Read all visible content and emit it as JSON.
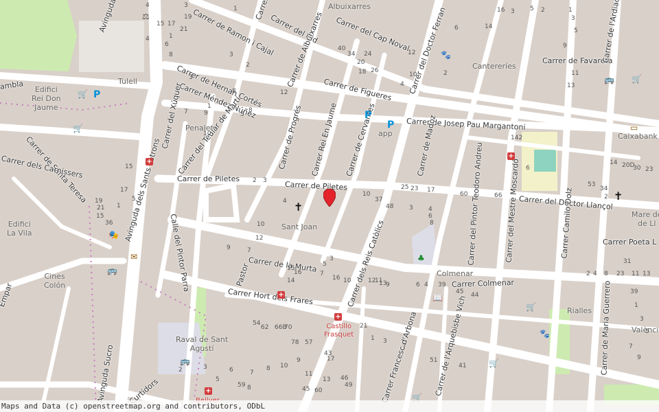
{
  "map": {
    "attribution": "Maps and Data (c) openstreetmap.org and contributors, ODbL",
    "marker": {
      "name": "location-pin-icon",
      "color": "#e3242b"
    },
    "colors": {
      "background": "#f2efe9",
      "buildings": "#d9d0c9",
      "roads": "#ffffff",
      "park": "#cdebb0",
      "pedestrian": "#dddde8"
    },
    "streets": [
      {
        "id": "s1",
        "label": "Avinguda Joan Calot"
      },
      {
        "id": "s2",
        "label": "Carrer de Ramon i Cajal"
      },
      {
        "id": "s3",
        "label": "Carrer del Cid"
      },
      {
        "id": "s4",
        "label": "Carrer del Cap Noval"
      },
      {
        "id": "s5",
        "label": "Carrer de Hernan Cortés"
      },
      {
        "id": "s6",
        "label": "Carrer de Albuixarres"
      },
      {
        "id": "s7",
        "label": "Carrer Méndez Núñez"
      },
      {
        "id": "s8",
        "label": "Carrer de Figueres"
      },
      {
        "id": "s9",
        "label": "Carrer del Doctor Ferran"
      },
      {
        "id": "s10",
        "label": "Carrer de Favareta"
      },
      {
        "id": "s11",
        "label": "Carrer de Josep Pau Margantoni"
      },
      {
        "id": "s12",
        "label": "Carrer del Teular de Martí"
      },
      {
        "id": "s13",
        "label": "Carrer del Xúquer"
      },
      {
        "id": "s14",
        "label": "Carrer de Progrés"
      },
      {
        "id": "s15",
        "label": "Carrer Rei En Jaume"
      },
      {
        "id": "s16",
        "label": "Carrer de Cervantes"
      },
      {
        "id": "s17",
        "label": "Carrer de Madoz"
      },
      {
        "id": "s18",
        "label": "Carrer de Piletes"
      },
      {
        "id": "s19",
        "label": "Carrer de Piletes"
      },
      {
        "id": "s20",
        "label": "Carrer del Pintor Teodoro Andreu"
      },
      {
        "id": "s21",
        "label": "Carrer del Mestre Moscardó"
      },
      {
        "id": "s22",
        "label": "Carrer del Doctor Llançol"
      },
      {
        "id": "s23",
        "label": "Carrer Camilo Dolz"
      },
      {
        "id": "s24",
        "label": "Carrer Poeta L"
      },
      {
        "id": "s25",
        "label": "Carrer de Santa Teresa"
      },
      {
        "id": "s26",
        "label": "Carrer dels Carnissers"
      },
      {
        "id": "s27",
        "label": "Avinguda dels Sants Patrons"
      },
      {
        "id": "s28",
        "label": "Calle del Pintor Parra"
      },
      {
        "id": "s29",
        "label": "Pastor"
      },
      {
        "id": "s30",
        "label": "Carrer de la Murta"
      },
      {
        "id": "s31",
        "label": "Carrer dels Reis Catòlics"
      },
      {
        "id": "s32",
        "label": "Carrer del Pintor Roig"
      },
      {
        "id": "s33",
        "label": "Carrer Colmenar"
      },
      {
        "id": "s34",
        "label": "Carrer Hort dels Frares"
      },
      {
        "id": "s35",
        "label": "Carrer Francesc d'Arbona"
      },
      {
        "id": "s36",
        "label": "Carrer de l'Arquebisbe Vich"
      },
      {
        "id": "s37",
        "label": "Carrer de Maria Guerrero"
      },
      {
        "id": "s38",
        "label": "Avinguda Sucro"
      },
      {
        "id": "s39",
        "label": "Curtidors"
      },
      {
        "id": "s40",
        "label": "Carrer de l'Ardiac"
      },
      {
        "id": "s41",
        "label": "ambla"
      },
      {
        "id": "s42",
        "label": "Empar"
      },
      {
        "id": "s43",
        "label": "Carrer de l'A"
      }
    ],
    "places": [
      {
        "id": "p1",
        "label": "Albuixarres"
      },
      {
        "id": "p2",
        "label": "Tulell"
      },
      {
        "id": "p3",
        "label": "Edifici\nRei Don\nJaume"
      },
      {
        "id": "p4",
        "label": "Penalet"
      },
      {
        "id": "p5",
        "label": "Cantereríes"
      },
      {
        "id": "p6",
        "label": "Caixabank"
      },
      {
        "id": "p7",
        "label": "app"
      },
      {
        "id": "p8",
        "label": "Sant Joan"
      },
      {
        "id": "p9",
        "label": "Edifici\nLa Vila"
      },
      {
        "id": "p10",
        "label": "Cines\nColón"
      },
      {
        "id": "p11",
        "label": "Colmenar"
      },
      {
        "id": "p12",
        "label": "Raval de Sant\nAgustí"
      },
      {
        "id": "p13",
        "label": "Rialles"
      },
      {
        "id": "p14",
        "label": "València"
      },
      {
        "id": "p15",
        "label": "Mare de\nde Ll"
      }
    ],
    "pois": [
      {
        "id": "poi1",
        "label": "Castillo\nFrasquet"
      },
      {
        "id": "poi2",
        "label": "Bellver"
      }
    ],
    "house_numbers": [
      "4",
      "3",
      "1",
      "3",
      "2",
      "4",
      "6",
      "8",
      "3",
      "9",
      "1",
      "7",
      "10",
      "5",
      "8",
      "40",
      "34",
      "24",
      "18",
      "20",
      "12",
      "26",
      "10",
      "4",
      "2",
      "6",
      "14",
      "16",
      "3",
      "5",
      "2",
      "1",
      "3",
      "5",
      "9",
      "11",
      "13",
      "15",
      "17",
      "19",
      "21",
      "15",
      "36",
      "1",
      "5",
      "8",
      "12",
      "2",
      "3",
      "4",
      "10",
      "37",
      "48",
      "25",
      "23",
      "17",
      "60",
      "66",
      "142",
      "6",
      "14",
      "20D",
      "30",
      "23",
      "53",
      "34",
      "2",
      "3",
      "4",
      "6",
      "8",
      "10",
      "12",
      "9",
      "7",
      "5",
      "3",
      "7",
      "16",
      "15",
      "16",
      "14",
      "10",
      "12",
      "11",
      "13",
      "9",
      "6",
      "4",
      "39",
      "45",
      "44",
      "2",
      "4",
      "8",
      "23",
      "31",
      "11",
      "13",
      "17",
      "21",
      "1",
      "3",
      "7",
      "51",
      "41",
      "43",
      "46",
      "49",
      "45",
      "60",
      "54",
      "62",
      "66B",
      "70",
      "78",
      "57",
      "59",
      "7",
      "8",
      "10",
      "9",
      "11",
      "13",
      "15",
      "17",
      "19",
      "21",
      "1",
      "2",
      "3",
      "5",
      "6",
      "8",
      "39",
      "1",
      "3",
      "5",
      "7",
      "9",
      "31",
      "25",
      "3",
      "4",
      "5"
    ]
  }
}
